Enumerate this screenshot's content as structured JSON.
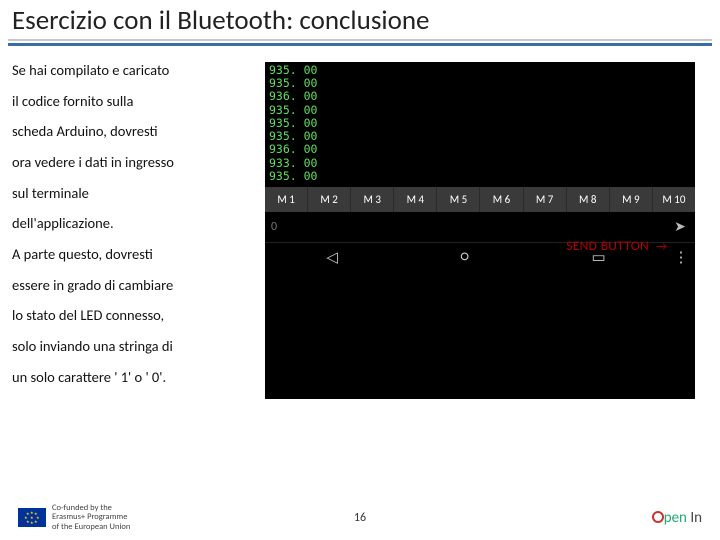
{
  "title": "Esercizio con il Bluetooth: conclusione",
  "left_para1_l1": "Se hai compilato e caricato",
  "left_para1_l2": "il codice fornito sulla",
  "left_para1_l3": "scheda Arduino, dovresti",
  "left_para1_l4": "ora vedere i dati in ingresso",
  "left_para1_l5": "sul terminale",
  "left_para1_l6": "dell'applicazione.",
  "left_para2_l1": "A parte questo, dovresti",
  "left_para2_l2": "essere in grado di cambiare",
  "left_para2_l3": "lo stato del LED connesso,",
  "left_para2_l4": "solo inviando una stringa di",
  "left_para2_l5": "un solo carattere ' 1' o ' 0'.",
  "terminal": [
    "935. 00",
    "935. 00",
    "936. 00",
    "935. 00",
    "935. 00",
    "935. 00",
    "936. 00",
    "933. 00",
    "935. 00"
  ],
  "macros": [
    "M 1",
    "M 2",
    "M 3",
    "M 4",
    "M 5",
    "M 6",
    "M 7",
    "M 8",
    "M 9",
    "M 10"
  ],
  "input_hint": "0",
  "send_label": "SEND BUTTON",
  "send_glyph": "➤",
  "nav": {
    "back": "◁",
    "home": "○",
    "recent": "▭",
    "menu": "⋮"
  },
  "footer": {
    "cofund_l1": "Co-funded by the",
    "cofund_l2": "Erasmus+ Programme",
    "cofund_l3": "of the European Union",
    "page": "16",
    "logo_pre": "pen",
    "logo_post": "In"
  }
}
